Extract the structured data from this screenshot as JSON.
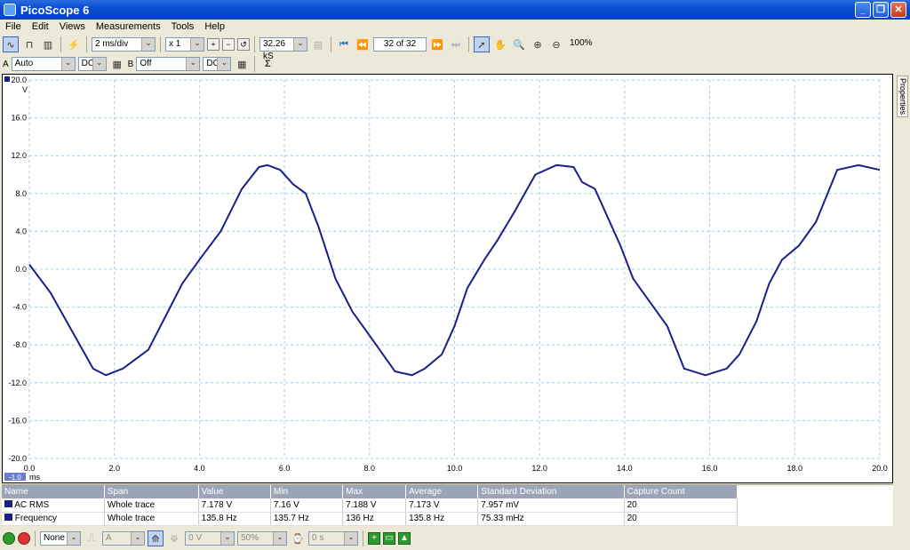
{
  "window": {
    "title": "PicoScope 6"
  },
  "menu": [
    "File",
    "Edit",
    "Views",
    "Measurements",
    "Tools",
    "Help"
  ],
  "toolbar": {
    "timebase": "2 ms/div",
    "zoom_factor": "x 1",
    "samples": "32.26 kS",
    "buffer_position": "32 of 32",
    "zoom_percent": "100%"
  },
  "channels": {
    "a_label": "A",
    "a_range": "Auto",
    "a_coupling": "DC",
    "b_label": "B",
    "b_range": "Off",
    "b_coupling": "DC",
    "sigma": "Σ"
  },
  "properties_tab": "Properties",
  "chart_data": {
    "type": "line",
    "ylabel": "V",
    "xlabel": "ms",
    "xlim": [
      0,
      20
    ],
    "ylim": [
      -20,
      20
    ],
    "x_ticks": [
      "0.0",
      "2.0",
      "4.0",
      "6.0",
      "8.0",
      "10.0",
      "12.0",
      "14.0",
      "16.0",
      "18.0",
      "20.0"
    ],
    "y_ticks": [
      "20.0",
      "16.0",
      "12.0",
      "8.0",
      "4.0",
      "0.0",
      "-4.0",
      "-8.0",
      "-12.0",
      "-16.0",
      "-20.0"
    ],
    "ruler_value": "-1.0",
    "line_color": "#1a1f8a",
    "series": [
      {
        "x": [
          0,
          0.5,
          1.0,
          1.5,
          1.8,
          2.2,
          2.5,
          2.8,
          3.2,
          3.6,
          4.0,
          4.5,
          5.0,
          5.4,
          5.6,
          5.9,
          6.2,
          6.5,
          6.8,
          7.2,
          7.6,
          8.0,
          8.6,
          9.0,
          9.3,
          9.7,
          10.0,
          10.3,
          10.7,
          11.0,
          11.4,
          11.9,
          12.4,
          12.8,
          13.0,
          13.3,
          13.6,
          13.9,
          14.2,
          14.6,
          15.0,
          15.4,
          15.9,
          16.4,
          16.7,
          17.1,
          17.4,
          17.7,
          18.1,
          18.5,
          19.0,
          19.5,
          20.0
        ],
        "y": [
          0.5,
          -2.5,
          -6.5,
          -10.5,
          -11.2,
          -10.5,
          -9.5,
          -8.5,
          -5.0,
          -1.5,
          1.0,
          4.0,
          8.5,
          10.8,
          11.0,
          10.5,
          9.0,
          8.0,
          4.5,
          -1.0,
          -4.5,
          -7.0,
          -10.8,
          -11.2,
          -10.5,
          -9.0,
          -6.0,
          -2.0,
          1.0,
          3.0,
          6.0,
          10.0,
          11.0,
          10.8,
          9.2,
          8.5,
          5.5,
          2.5,
          -1.0,
          -3.5,
          -6.0,
          -10.5,
          -11.2,
          -10.5,
          -9.0,
          -5.5,
          -1.5,
          1.0,
          2.5,
          5.0,
          10.5,
          11.0,
          10.5
        ]
      }
    ]
  },
  "measurements": {
    "headers": [
      "Name",
      "Span",
      "Value",
      "Min",
      "Max",
      "Average",
      "Standard Deviation",
      "Capture Count"
    ],
    "rows": [
      [
        "AC RMS",
        "Whole trace",
        "7.178 V",
        "7.16 V",
        "7.188 V",
        "7.173 V",
        "7.957 mV",
        "20"
      ],
      [
        "Frequency",
        "Whole trace",
        "135.8 Hz",
        "135.7 Hz",
        "136 Hz",
        "135.8 Hz",
        "75.33 mHz",
        "20"
      ]
    ]
  },
  "bottom": {
    "trigger_mode": "None",
    "trigger_channel": "A",
    "trigger_level": "0 V",
    "pretrigger": "50%",
    "delay": "0 s"
  }
}
